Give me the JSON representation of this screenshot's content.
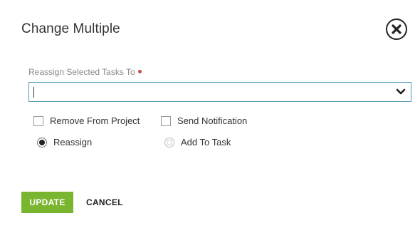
{
  "dialog": {
    "title": "Change Multiple",
    "close_icon": "close-circle-icon"
  },
  "reassign_field": {
    "label": "Reassign Selected Tasks To",
    "value": "",
    "required": true,
    "required_color": "#c94a4a",
    "dropdown_icon": "chevron-down-icon",
    "border_color": "#4f9cb3"
  },
  "options": {
    "remove_from_project": {
      "label": "Remove From Project",
      "checked": false
    },
    "send_notification": {
      "label": "Send Notification",
      "checked": false
    },
    "reassign": {
      "label": "Reassign",
      "selected": true
    },
    "add_to_task": {
      "label": "Add To Task",
      "selected": false,
      "disabled": true
    }
  },
  "actions": {
    "update_label": "UPDATE",
    "cancel_label": "CANCEL",
    "update_color": "#7ab530"
  }
}
